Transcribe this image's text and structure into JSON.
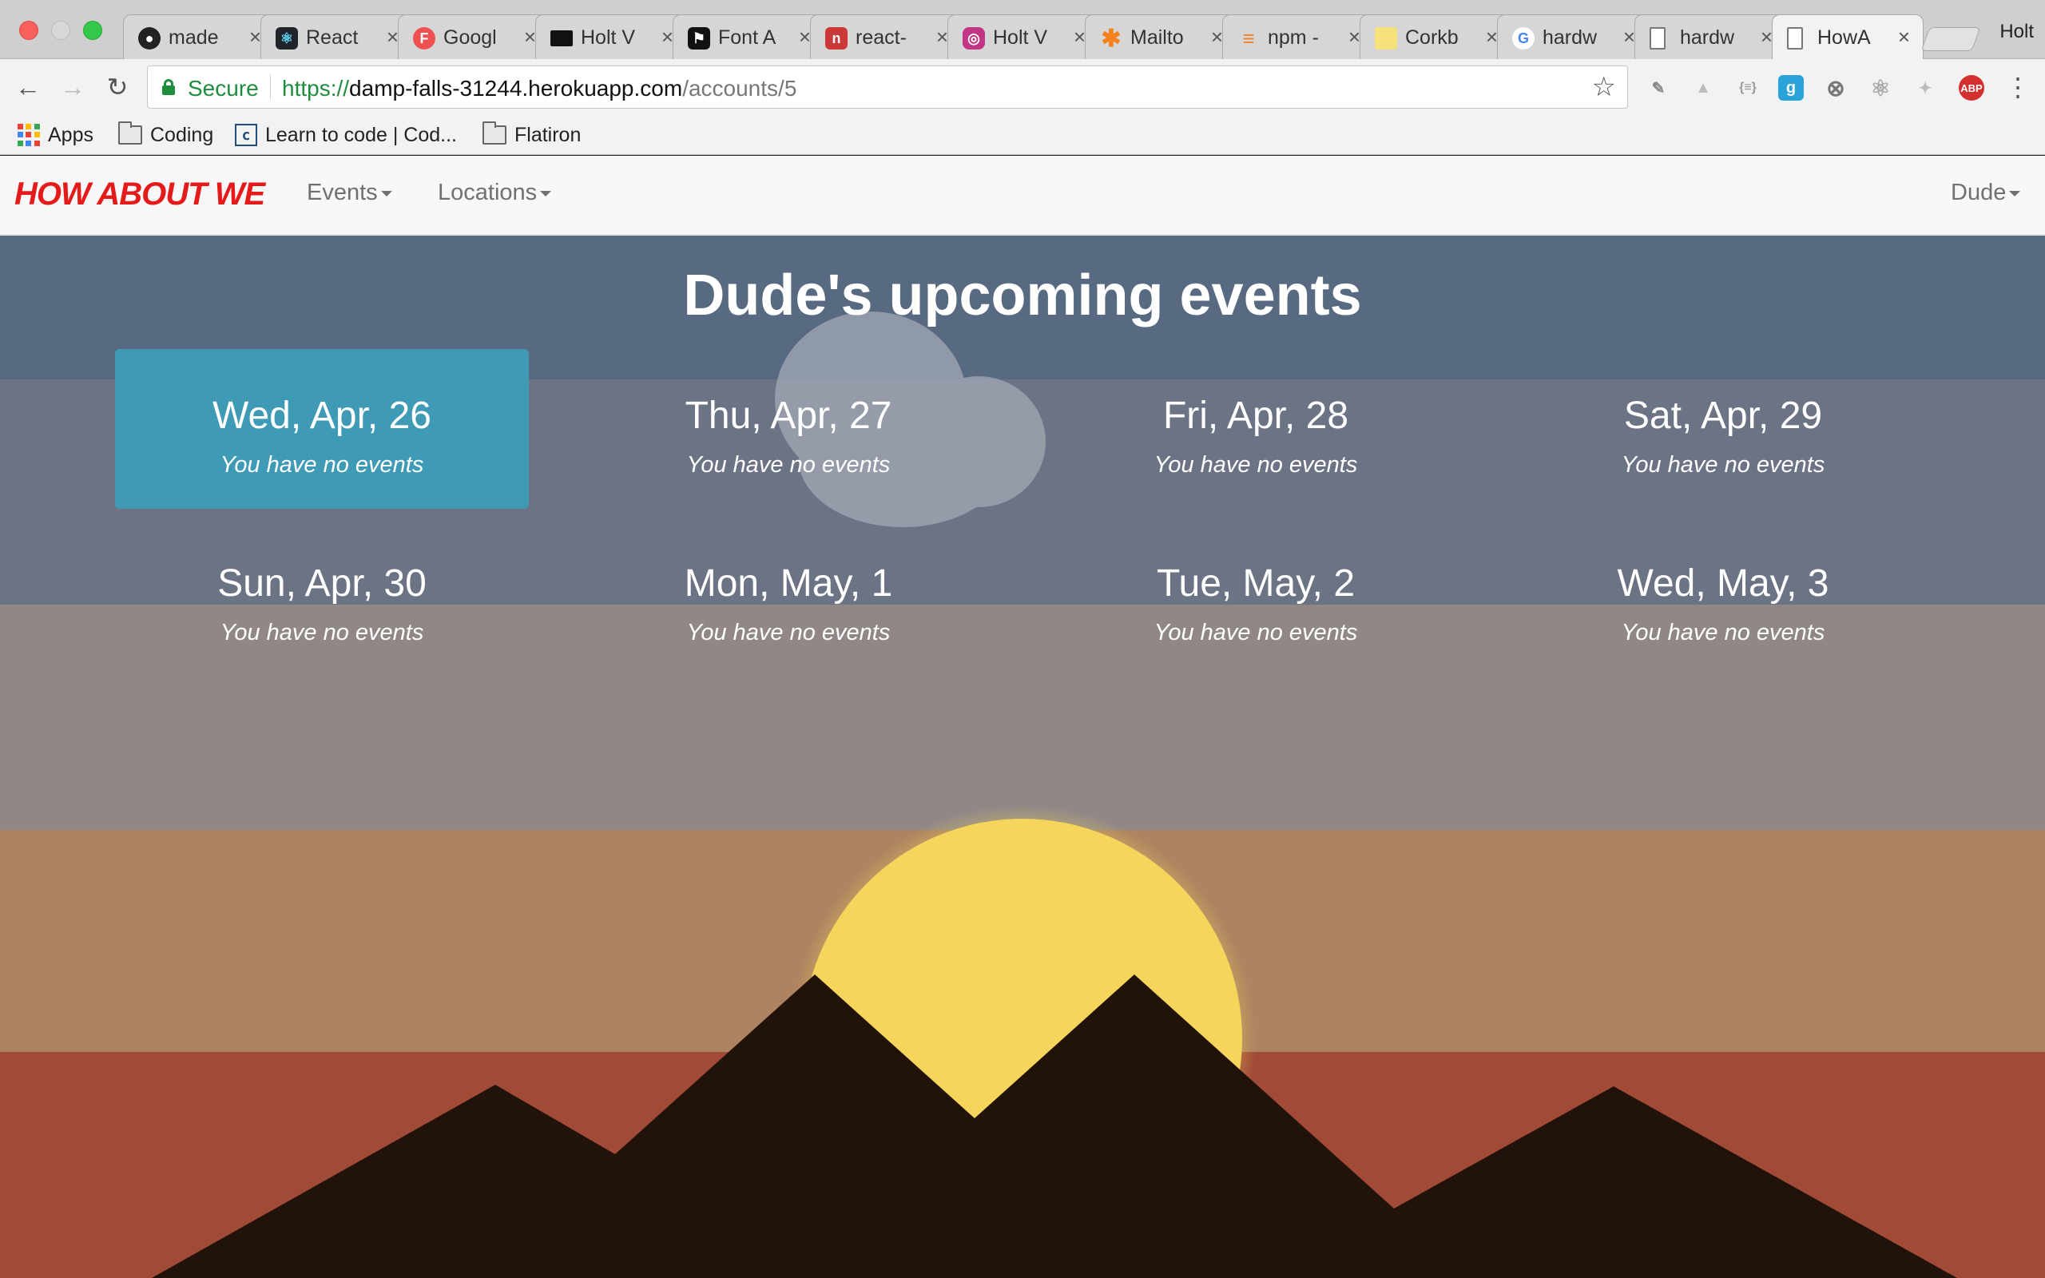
{
  "browser": {
    "tabs": [
      {
        "title": "made",
        "favicon": "github-icon",
        "color": "#222222"
      },
      {
        "title": "React",
        "favicon": "react-icon",
        "color": "#20232a"
      },
      {
        "title": "Googl",
        "favicon": "font-f-icon",
        "color": "#ee4f4f"
      },
      {
        "title": "Holt V",
        "favicon": "monitor-icon",
        "color": "#111111"
      },
      {
        "title": "Font A",
        "favicon": "flag-icon",
        "color": "#111111"
      },
      {
        "title": "react-",
        "favicon": "npm-icon",
        "color": "#cb3837"
      },
      {
        "title": "Holt V",
        "favicon": "instagram-icon",
        "color": "#c13584"
      },
      {
        "title": "Mailto",
        "favicon": "asterisk-icon",
        "color": "#f5821f"
      },
      {
        "title": "npm -",
        "favicon": "stackoverflow-icon",
        "color": "#f48024"
      },
      {
        "title": "Corkb",
        "favicon": "note-icon",
        "color": "#f6e27a"
      },
      {
        "title": "hardw",
        "favicon": "google-icon",
        "color": "#4285f4"
      },
      {
        "title": "hardw",
        "favicon": "document-icon",
        "color": "#888888"
      },
      {
        "title": "HowA",
        "favicon": "document-icon",
        "color": "#888888"
      }
    ],
    "profile_name": "Holt",
    "secure_label": "Secure",
    "url": {
      "scheme": "https://",
      "host": "damp-falls-31244.herokuapp.com",
      "path": "/accounts/5"
    },
    "bookmarks": [
      {
        "label": "Apps",
        "icon": "apps-grid-icon"
      },
      {
        "label": "Coding",
        "icon": "folder-icon"
      },
      {
        "label": "Learn to code | Cod...",
        "icon": "codecademy-icon"
      },
      {
        "label": "Flatiron",
        "icon": "folder-icon"
      }
    ]
  },
  "app": {
    "brand": "HOW ABOUT WE",
    "nav": {
      "events": "Events",
      "locations": "Locations",
      "user": "Dude"
    },
    "heading": "Dude's upcoming events",
    "days": [
      {
        "date": "Wed, Apr, 26",
        "status": "You have no events",
        "highlighted": true
      },
      {
        "date": "Thu, Apr, 27",
        "status": "You have no events"
      },
      {
        "date": "Fri, Apr, 28",
        "status": "You have no events"
      },
      {
        "date": "Sat, Apr, 29",
        "status": "You have no events"
      },
      {
        "date": "Sun, Apr, 30",
        "status": "You have no events"
      },
      {
        "date": "Mon, May, 1",
        "status": "You have no events"
      },
      {
        "date": "Tue, May, 2",
        "status": "You have no events"
      },
      {
        "date": "Wed, May, 3",
        "status": "You have no events"
      }
    ],
    "colors": {
      "sky_top": "#586982",
      "sky_mid": "#6b7385",
      "haze": "#918886",
      "dusk": "#ad8361",
      "ground": "#a04a37",
      "sun": "#f5d55c",
      "mountains": "#22130a",
      "highlight": "#3e9ab5",
      "brand_red": "#e51a1a"
    }
  }
}
